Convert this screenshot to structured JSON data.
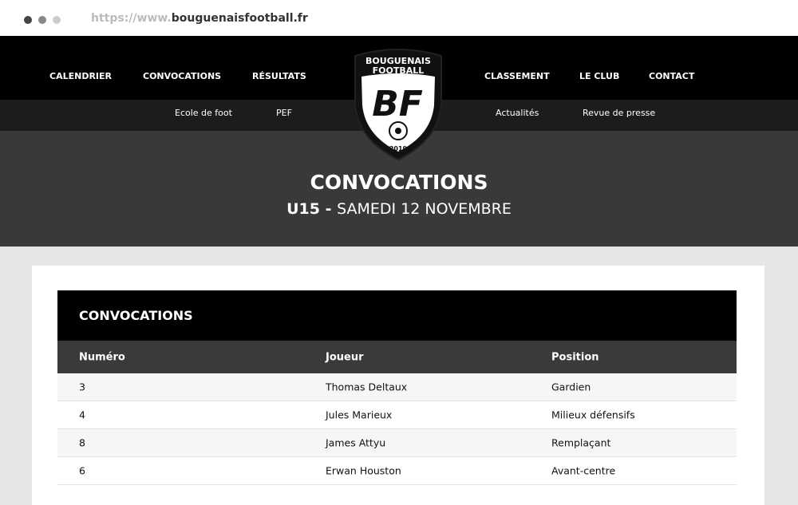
{
  "browser": {
    "url_prefix": "https://www.",
    "url_domain": "bouguenaisfootball.fr"
  },
  "nav": {
    "left": [
      "CALENDRIER",
      "CONVOCATIONS",
      "RÉSULTATS"
    ],
    "right": [
      "CLASSEMENT",
      "LE CLUB",
      "CONTACT"
    ]
  },
  "subnav": {
    "left": [
      "Ecole de foot",
      "PEF"
    ],
    "right": [
      "Actualités",
      "Revue de presse"
    ]
  },
  "logo": {
    "top": "BOUGUENAIS",
    "middle": "FOOTBALL",
    "initials": "BF",
    "year": "2019"
  },
  "hero": {
    "title": "CONVOCATIONS",
    "team": "U15",
    "separator": " - ",
    "date": "SAMEDI 12 NOVEMBRE"
  },
  "table": {
    "title": "CONVOCATIONS",
    "columns": [
      "Numéro",
      "Joueur",
      "Position"
    ],
    "rows": [
      [
        "3",
        "Thomas Deltaux",
        "Gardien"
      ],
      [
        "4",
        "Jules Marieux",
        "Milieux défensifs"
      ],
      [
        "8",
        "James Attyu",
        "Remplaçant"
      ],
      [
        "6",
        "Erwan Houston",
        "Avant-centre"
      ]
    ]
  }
}
